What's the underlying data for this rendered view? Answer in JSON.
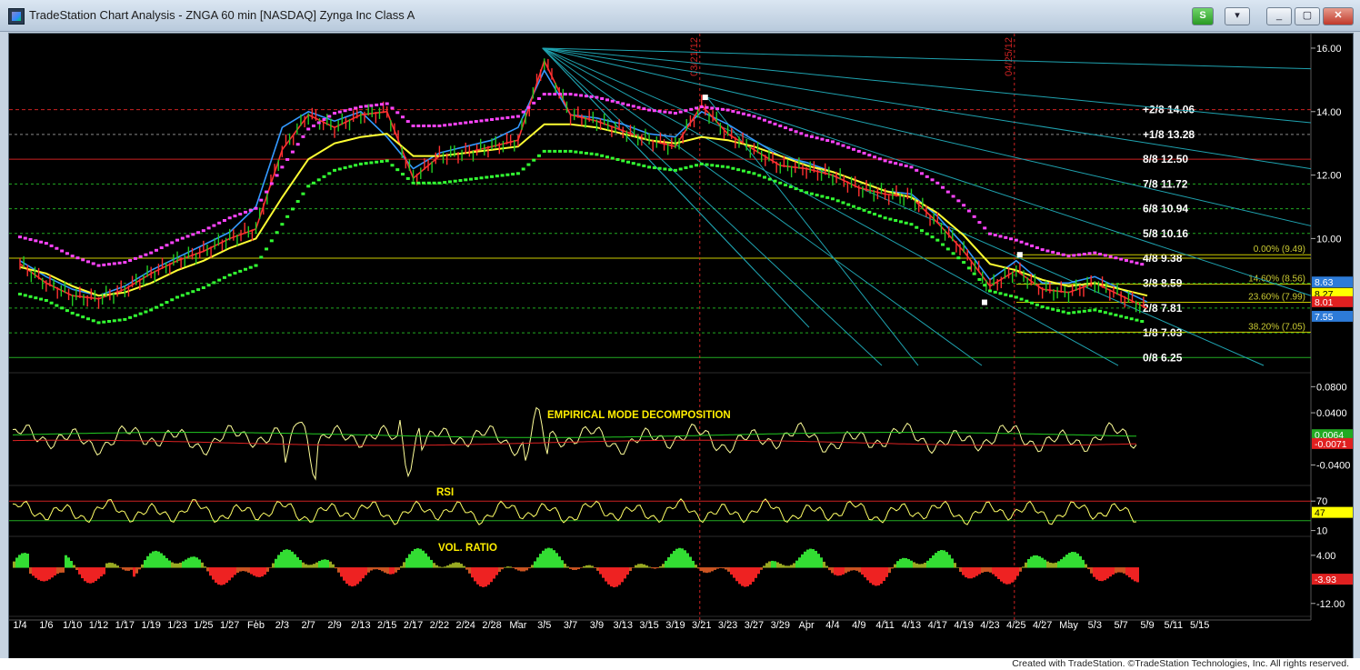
{
  "window": {
    "title": "TradeStation Chart Analysis - ZNGA 60 min [NASDAQ] Zynga Inc Class A",
    "btn_s": "S",
    "btn_menu": "▾",
    "btn_min": "_",
    "btn_restore": "▢",
    "btn_close": "✕",
    "footer": "Created with TradeStation. ©TradeStation Technologies, Inc. All rights reserved."
  },
  "colors": {
    "background": "#000000",
    "price_bar_up": "#22cc22",
    "price_bar_down": "#ff3030",
    "upper_dots": "#ff44ff",
    "lower_dots": "#33ff33",
    "ma_yellow": "#ffff33",
    "ma_blue": "#3399ff",
    "ma_red": "#ff3030",
    "ma_green": "#33cc33",
    "fan_lines": "#1fa3b0",
    "murrey_red": "#cc2222",
    "murrey_yellow": "#cccc00",
    "murrey_green": "#22aa22",
    "indicator_label": "#ffee00"
  },
  "chart_data": [
    {
      "type": "line",
      "panel": "price",
      "symbol": "ZNGA",
      "interval": "60 min",
      "ylim": [
        5.8,
        16.4
      ],
      "y_ticks": [
        "16.00",
        "14.00",
        "12.00",
        "10.00"
      ],
      "x_dates": [
        "1/4",
        "1/6",
        "1/10",
        "1/12",
        "1/17",
        "1/19",
        "1/23",
        "1/25",
        "1/27",
        "Feb",
        "2/3",
        "2/7",
        "2/9",
        "2/13",
        "2/15",
        "2/17",
        "2/22",
        "2/24",
        "2/28",
        "Mar",
        "3/5",
        "3/7",
        "3/9",
        "3/13",
        "3/15",
        "3/19",
        "3/21",
        "3/23",
        "3/27",
        "3/29",
        "Apr",
        "4/4",
        "4/9",
        "4/11",
        "4/13",
        "4/17",
        "4/19",
        "4/23",
        "4/25",
        "4/27",
        "May",
        "5/3",
        "5/7",
        "5/9",
        "5/11",
        "5/15"
      ],
      "x_ticks": [
        "1/4",
        "1/6",
        "1/10",
        "1/12",
        "1/17",
        "1/19",
        "1/23",
        "1/25",
        "1/27",
        "Feb",
        "2/3",
        "2/7",
        "2/9",
        "2/13",
        "2/15",
        "2/17",
        "2/22",
        "2/24",
        "2/28",
        "Mar",
        "3/5",
        "3/7",
        "3/9",
        "3/13",
        "3/15",
        "3/19",
        "3/21",
        "3/23",
        "3/27",
        "3/29",
        "Apr",
        "4/4",
        "4/9",
        "4/11",
        "4/13",
        "4/17",
        "4/19",
        "4/23",
        "4/25",
        "4/27",
        "May",
        "5/3",
        "5/7",
        "5/9",
        "5/11",
        "5/15"
      ],
      "series": [
        {
          "values": [
            9.2,
            8.6,
            8.2,
            8.1,
            8.4,
            8.9,
            9.3,
            9.6,
            10.0,
            10.3,
            12.8,
            13.9,
            13.5,
            13.9,
            14.0,
            11.9,
            12.6,
            12.7,
            12.9,
            13.1,
            15.6,
            13.9,
            13.7,
            13.4,
            13.1,
            12.9,
            14.2,
            13.3,
            12.8,
            12.3,
            12.2,
            12.0,
            11.6,
            11.4,
            11.3,
            10.5,
            9.6,
            8.5,
            9.0,
            8.4,
            8.3,
            8.6,
            8.2,
            7.8,
            null,
            null
          ]
        },
        {
          "values": [
            9.1,
            8.9,
            8.5,
            8.2,
            8.3,
            8.6,
            9.0,
            9.3,
            9.7,
            10.0,
            11.3,
            12.5,
            13.0,
            13.2,
            13.3,
            12.6,
            12.6,
            12.7,
            12.8,
            12.9,
            13.6,
            13.6,
            13.5,
            13.3,
            13.1,
            13.0,
            13.2,
            13.1,
            12.9,
            12.6,
            12.3,
            12.1,
            11.8,
            11.5,
            11.3,
            10.8,
            10.1,
            9.2,
            9.0,
            8.7,
            8.5,
            8.6,
            8.4,
            8.2,
            null,
            null
          ]
        },
        {
          "values": [
            9.3,
            8.8,
            8.4,
            8.2,
            8.5,
            9.0,
            9.4,
            9.8,
            10.2,
            11.0,
            13.5,
            14.0,
            13.7,
            14.0,
            13.2,
            12.2,
            12.7,
            12.9,
            13.1,
            13.5,
            15.3,
            13.9,
            13.8,
            13.6,
            13.3,
            13.2,
            14.0,
            13.6,
            13.1,
            12.6,
            12.4,
            12.1,
            11.8,
            11.5,
            11.4,
            10.7,
            9.8,
            8.7,
            9.3,
            8.6,
            8.6,
            8.8,
            8.4,
            8.0,
            null,
            null
          ]
        }
      ],
      "gann_fan": {
        "origin": "3/5",
        "origin_price": 16.0
      },
      "vertical_markers": [
        {
          "label": "03/21/12",
          "x": "3/21"
        },
        {
          "label": "04/25/12",
          "x": "4/25"
        }
      ],
      "murrey_levels": [
        {
          "label": "+2/8",
          "value": "14.06"
        },
        {
          "label": "+1/8",
          "value": "13.28"
        },
        {
          "label": "8/8",
          "value": "12.50"
        },
        {
          "label": "7/8",
          "value": "11.72"
        },
        {
          "label": "6/8",
          "value": "10.94"
        },
        {
          "label": "5/8",
          "value": "10.16"
        },
        {
          "label": "4/8",
          "value": "9.38"
        },
        {
          "label": "3/8",
          "value": "8.59"
        },
        {
          "label": "2/8",
          "value": "7.81"
        },
        {
          "label": "1/8",
          "value": "7.03"
        },
        {
          "label": "0/8",
          "value": "6.25"
        }
      ],
      "fib_levels": [
        {
          "text": "0.00% (9.49)",
          "price": 9.49
        },
        {
          "text": "14.60% (8.56)",
          "price": 8.56
        },
        {
          "text": "23.60% (7.99)",
          "price": 7.99
        },
        {
          "text": "38.20% (7.05)",
          "price": 7.05
        }
      ],
      "last_value_tags": [
        {
          "text": "8.63",
          "color": "#2d7bd8",
          "price": 8.63
        },
        {
          "text": "8.27",
          "color": "#ffff00",
          "price": 8.27
        },
        {
          "text": "8.01",
          "color": "#e02020",
          "price": 8.01
        },
        {
          "text": "7.55",
          "color": "#2d7bd8",
          "price": 7.55
        }
      ]
    },
    {
      "type": "line",
      "panel": "emd",
      "title": "EMPIRICAL MODE DECOMPOSITION",
      "ylim": [
        -0.07,
        0.1
      ],
      "y_ticks": [
        "0.0800",
        "0.0400",
        "-0.0400"
      ],
      "last_value_tags": [
        {
          "text": "0.0064",
          "color": "#22aa22",
          "value": 0.0064
        },
        {
          "text": "-0.0071",
          "color": "#e02020",
          "value": -0.0071
        }
      ]
    },
    {
      "type": "line",
      "panel": "rsi",
      "title": "RSI",
      "ylim": [
        0,
        100
      ],
      "y_ticks": [
        "70",
        "10"
      ],
      "last_value_tags": [
        {
          "text": "47",
          "color": "#ffff00",
          "value": 47
        }
      ]
    },
    {
      "type": "area",
      "panel": "vol_ratio",
      "title": "VOL. RATIO",
      "ylim": [
        -16,
        10
      ],
      "y_ticks": [
        "4.00",
        "-12.00"
      ],
      "last_value_tags": [
        {
          "text": "-3.93",
          "color": "#e02020",
          "value": -3.93
        }
      ]
    }
  ]
}
